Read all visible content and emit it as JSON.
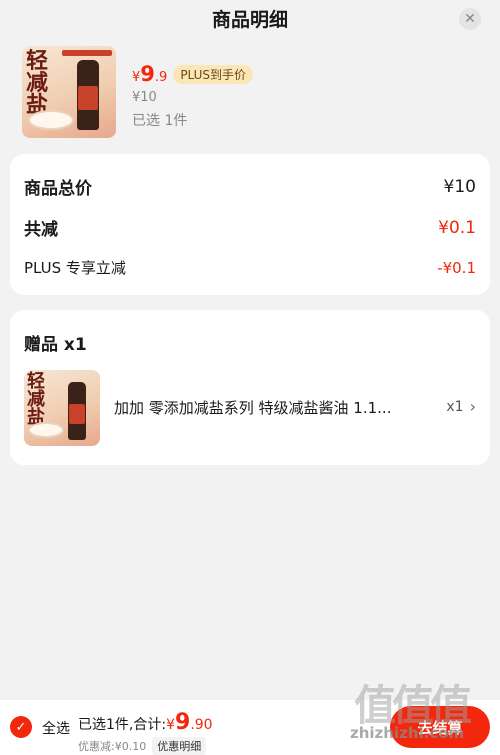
{
  "header": {
    "title": "商品明细"
  },
  "product": {
    "price_symbol": "¥",
    "price_integer": "9",
    "price_decimal": ".9",
    "plus_tag": "PLUS到手价",
    "original_price": "¥10",
    "selected": "已选 1件",
    "thumb_text": "轻减盐"
  },
  "summary": {
    "total_label": "商品总价",
    "total_value": "¥10",
    "reduce_label": "共减",
    "reduce_value": "¥0.1",
    "plus_label": "PLUS 专享立减",
    "plus_value": "-¥0.1"
  },
  "gift": {
    "title": "赠品 x1",
    "name": "加加 零添加减盐系列 特级减盐酱油 1.1...",
    "qty": "x1",
    "thumb_text": "轻减盐"
  },
  "footer": {
    "select_all": "全选",
    "selected_total_label": "已选1件,合计:",
    "total_symbol": "¥",
    "total_integer": "9",
    "total_decimal": ".90",
    "discount_text": "优惠减:¥0.10",
    "detail_button": "优惠明细",
    "checkout_button": "去结算"
  },
  "watermark": {
    "glyphs": "值值值",
    "url": "zhizhizhi.com"
  },
  "colors": {
    "accent": "#f2270c",
    "plus_tag_bg": "#fbe6b8"
  }
}
